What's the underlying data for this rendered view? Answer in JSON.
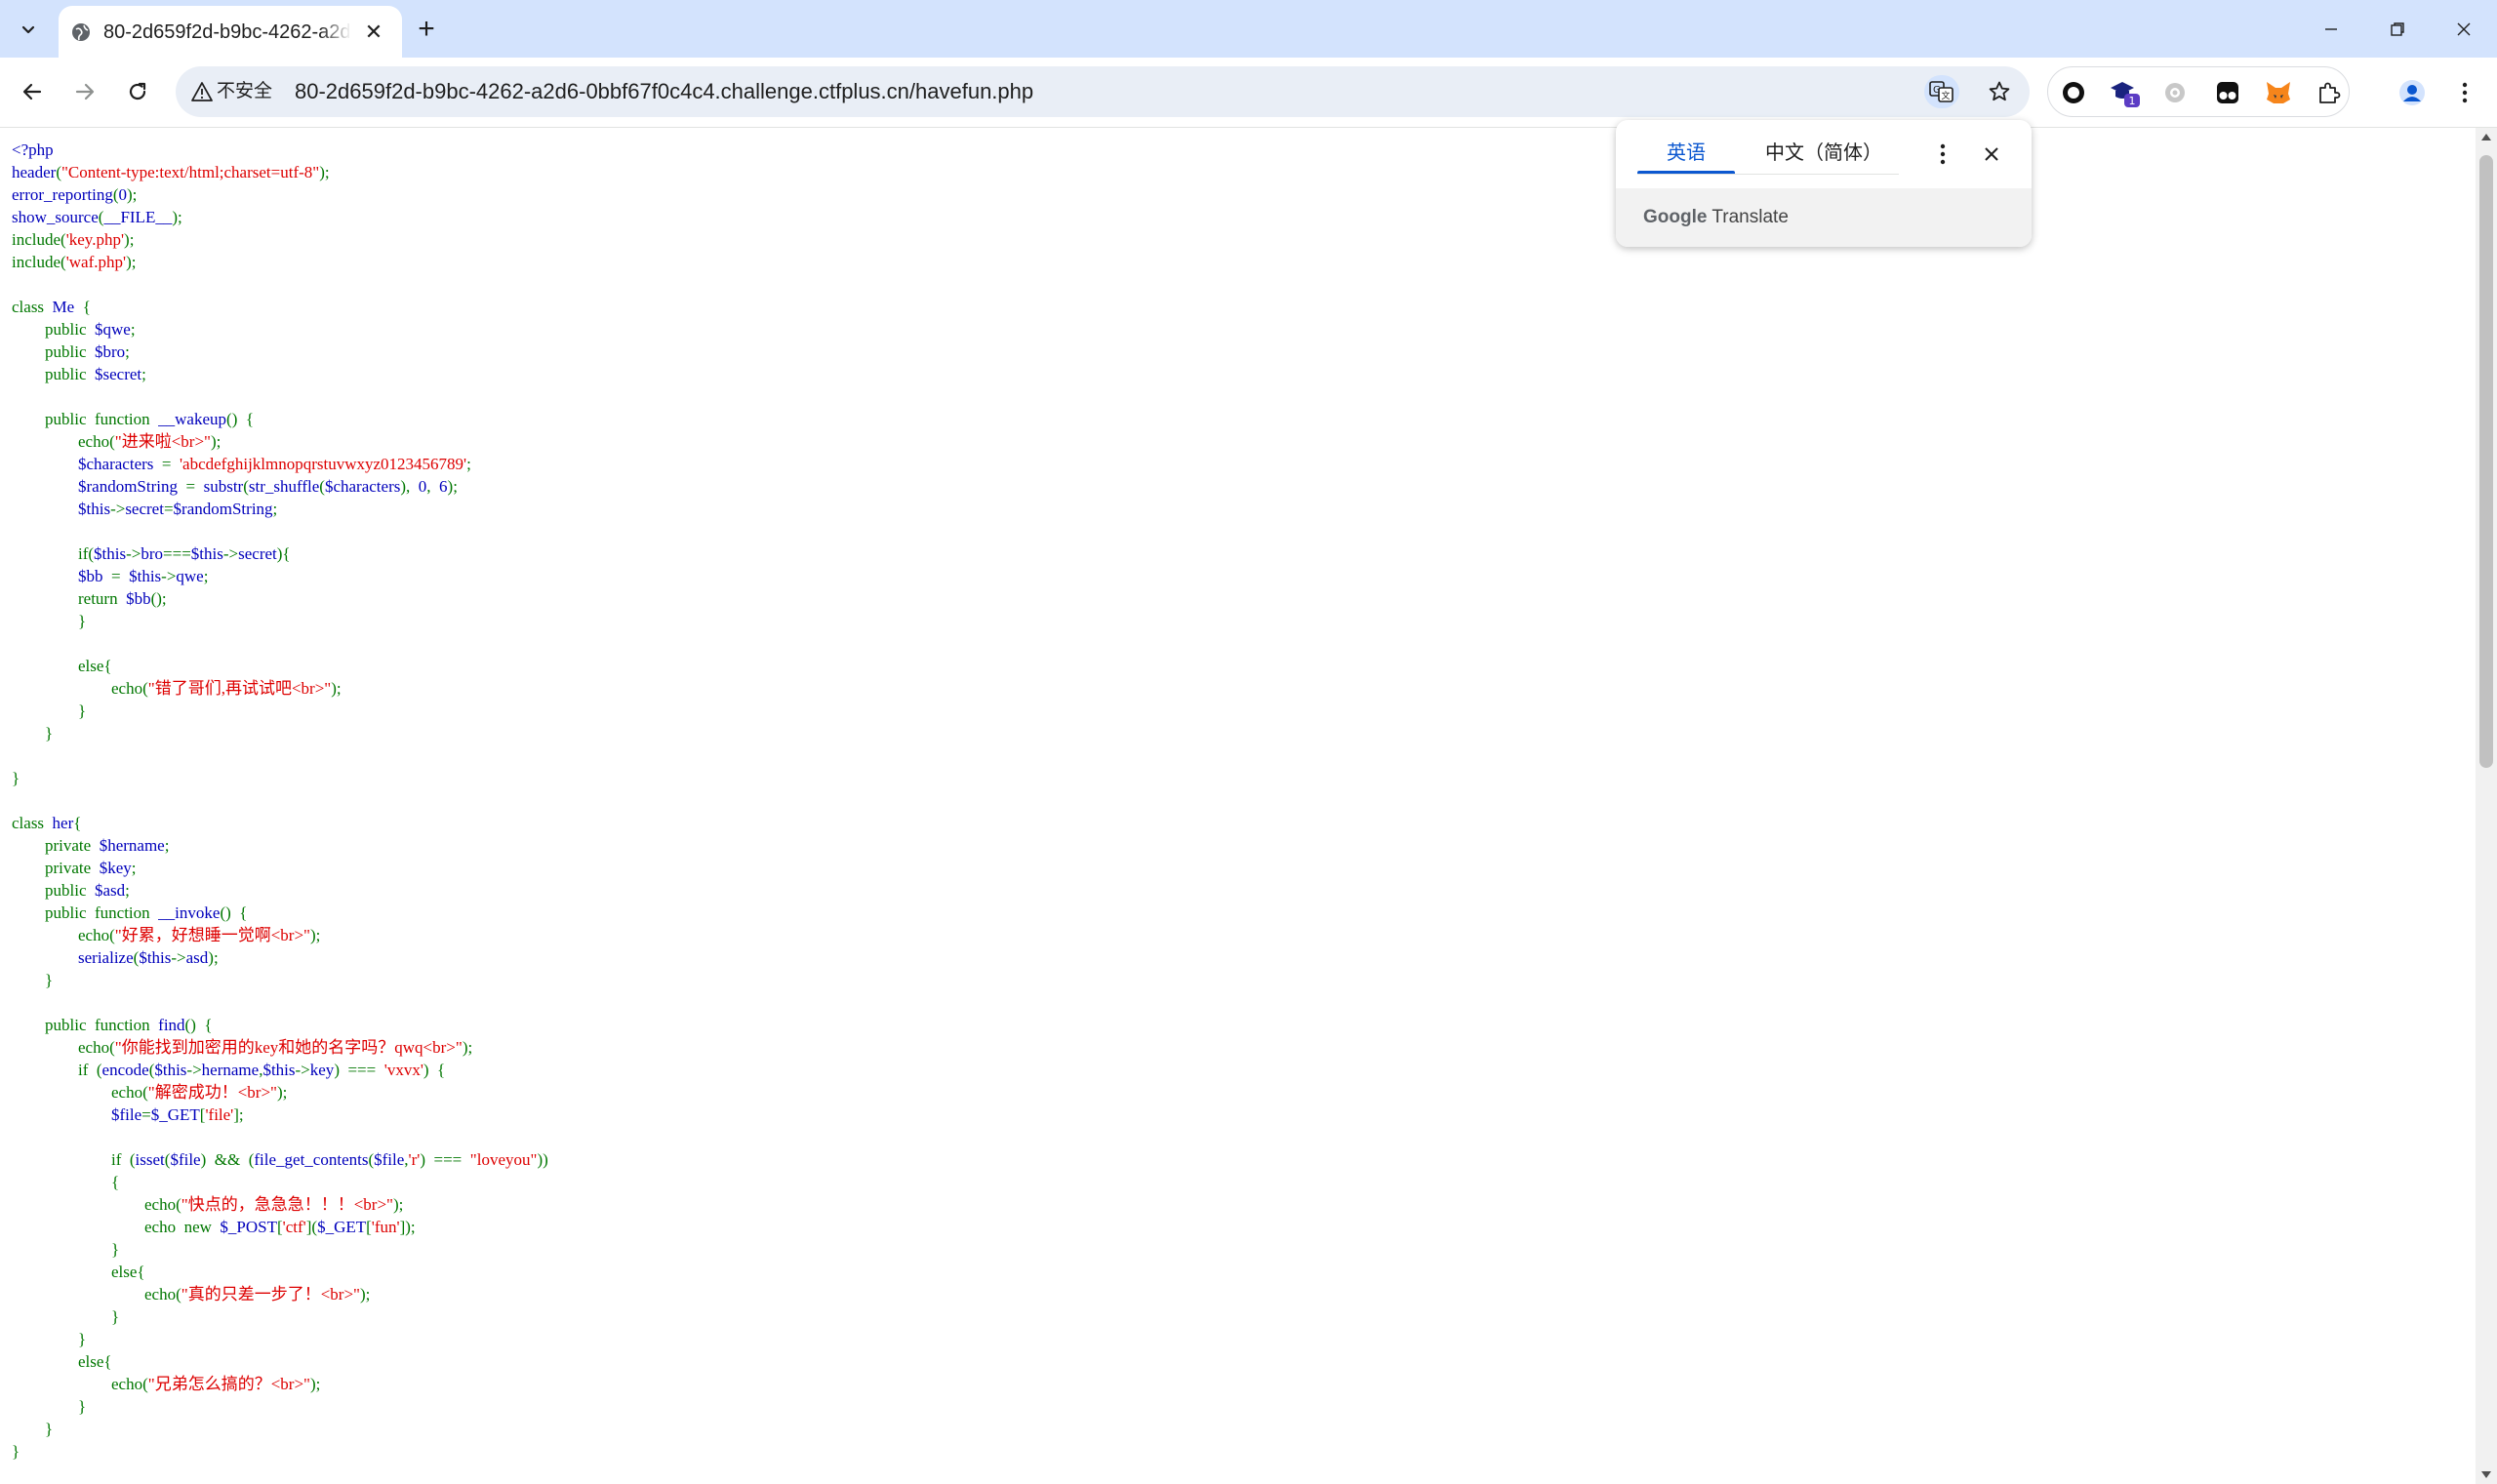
{
  "tab": {
    "title": "80-2d659f2d-b9bc-4262-a2d6-0bbf67f0c4c4.challenge.ctfplus.cn/havefun.php",
    "close_glyph": "✕",
    "new_tab_glyph": "+",
    "search_glyph": "⌄"
  },
  "address_bar": {
    "security_label": "不安全",
    "url": "80-2d659f2d-b9bc-4262-a2d6-0bbf67f0c4c4.challenge.ctfplus.cn/havefun.php"
  },
  "translate_popup": {
    "tab_source": "英语",
    "tab_target": "中文（简体）",
    "brand_google": "Google",
    "brand_translate": "Translate"
  },
  "icons": {
    "back": "back-arrow-icon",
    "forward": "forward-arrow-icon",
    "reload": "reload-icon",
    "warning": "warning-icon",
    "translate": "translate-icon",
    "bookmark": "star-icon",
    "profile": "profile-icon",
    "menu": "kebab-menu-icon"
  },
  "extensions": [
    {
      "name": "record-extension-icon"
    },
    {
      "name": "graduation-cap-extension-icon",
      "badge": "1"
    },
    {
      "name": "gear-extension-icon"
    },
    {
      "name": "tampermonkey-extension-icon"
    },
    {
      "name": "metamask-fox-extension-icon"
    },
    {
      "name": "puzzle-piece-extension-icon"
    }
  ],
  "code_lines": [
    [
      [
        "d",
        "<?php"
      ]
    ],
    [
      [
        "d",
        "header"
      ],
      [
        "k",
        "("
      ],
      [
        "s",
        "\"Content-type:text/html;charset=utf-8\""
      ],
      [
        "k",
        ");"
      ]
    ],
    [
      [
        "d",
        "error_reporting"
      ],
      [
        "k",
        "("
      ],
      [
        "d",
        "0"
      ],
      [
        "k",
        ");"
      ]
    ],
    [
      [
        "d",
        "show_source"
      ],
      [
        "k",
        "("
      ],
      [
        "d",
        "__FILE__"
      ],
      [
        "k",
        ");"
      ]
    ],
    [
      [
        "k",
        "include("
      ],
      [
        "s",
        "'key.php'"
      ],
      [
        "k",
        ");"
      ]
    ],
    [
      [
        "k",
        "include("
      ],
      [
        "s",
        "'waf.php'"
      ],
      [
        "k",
        ");"
      ]
    ],
    [],
    [
      [
        "k",
        "class  "
      ],
      [
        "d",
        "Me  "
      ],
      [
        "k",
        "{"
      ]
    ],
    [
      [
        "d",
        "\t"
      ],
      [
        "k",
        "public  "
      ],
      [
        "d",
        "$qwe"
      ],
      [
        "k",
        ";"
      ]
    ],
    [
      [
        "d",
        "\t"
      ],
      [
        "k",
        "public  "
      ],
      [
        "d",
        "$bro"
      ],
      [
        "k",
        ";"
      ]
    ],
    [
      [
        "d",
        "\t"
      ],
      [
        "k",
        "public  "
      ],
      [
        "d",
        "$secret"
      ],
      [
        "k",
        ";"
      ]
    ],
    [],
    [
      [
        "d",
        "\t"
      ],
      [
        "k",
        "public  function  "
      ],
      [
        "d",
        "__wakeup"
      ],
      [
        "k",
        "()  {"
      ]
    ],
    [
      [
        "d",
        "\t\t"
      ],
      [
        "k",
        "echo("
      ],
      [
        "s",
        "\"进来啦<br>\""
      ],
      [
        "k",
        ");"
      ]
    ],
    [
      [
        "d",
        "\t\t$characters  "
      ],
      [
        "k",
        "=  "
      ],
      [
        "s",
        "'abcdefghijklmnopqrstuvwxyz0123456789'"
      ],
      [
        "k",
        ";"
      ]
    ],
    [
      [
        "d",
        "\t\t$randomString  "
      ],
      [
        "k",
        "=  "
      ],
      [
        "d",
        "substr"
      ],
      [
        "k",
        "("
      ],
      [
        "d",
        "str_shuffle"
      ],
      [
        "k",
        "("
      ],
      [
        "d",
        "$characters"
      ],
      [
        "k",
        "),  "
      ],
      [
        "d",
        "0"
      ],
      [
        "k",
        ",  "
      ],
      [
        "d",
        "6"
      ],
      [
        "k",
        ");"
      ]
    ],
    [
      [
        "d",
        "\t\t$this"
      ],
      [
        "k",
        "->"
      ],
      [
        "d",
        "secret"
      ],
      [
        "k",
        "="
      ],
      [
        "d",
        "$randomString"
      ],
      [
        "k",
        ";"
      ]
    ],
    [],
    [
      [
        "d",
        "\t\t"
      ],
      [
        "k",
        "if("
      ],
      [
        "d",
        "$this"
      ],
      [
        "k",
        "->"
      ],
      [
        "d",
        "bro"
      ],
      [
        "k",
        "==="
      ],
      [
        "d",
        "$this"
      ],
      [
        "k",
        "->"
      ],
      [
        "d",
        "secret"
      ],
      [
        "k",
        "){"
      ]
    ],
    [
      [
        "d",
        "\t\t$bb  "
      ],
      [
        "k",
        "=  "
      ],
      [
        "d",
        "$this"
      ],
      [
        "k",
        "->"
      ],
      [
        "d",
        "qwe"
      ],
      [
        "k",
        ";"
      ]
    ],
    [
      [
        "d",
        "\t\t"
      ],
      [
        "k",
        "return  "
      ],
      [
        "d",
        "$bb"
      ],
      [
        "k",
        "();"
      ]
    ],
    [
      [
        "d",
        "\t\t"
      ],
      [
        "k",
        "}"
      ]
    ],
    [],
    [
      [
        "d",
        "\t\t"
      ],
      [
        "k",
        "else{"
      ]
    ],
    [
      [
        "d",
        "\t\t\t"
      ],
      [
        "k",
        "echo("
      ],
      [
        "s",
        "\"错了哥们,再试试吧<br>\""
      ],
      [
        "k",
        ");"
      ]
    ],
    [
      [
        "d",
        "\t\t"
      ],
      [
        "k",
        "}"
      ]
    ],
    [
      [
        "d",
        "\t"
      ],
      [
        "k",
        "}"
      ]
    ],
    [],
    [
      [
        "k",
        "}"
      ]
    ],
    [],
    [
      [
        "k",
        "class  "
      ],
      [
        "d",
        "her"
      ],
      [
        "k",
        "{"
      ]
    ],
    [
      [
        "d",
        "\t"
      ],
      [
        "k",
        "private  "
      ],
      [
        "d",
        "$hername"
      ],
      [
        "k",
        ";"
      ]
    ],
    [
      [
        "d",
        "\t"
      ],
      [
        "k",
        "private  "
      ],
      [
        "d",
        "$key"
      ],
      [
        "k",
        ";"
      ]
    ],
    [
      [
        "d",
        "\t"
      ],
      [
        "k",
        "public  "
      ],
      [
        "d",
        "$asd"
      ],
      [
        "k",
        ";"
      ]
    ],
    [
      [
        "d",
        "\t"
      ],
      [
        "k",
        "public  function  "
      ],
      [
        "d",
        "__invoke"
      ],
      [
        "k",
        "()  {"
      ]
    ],
    [
      [
        "d",
        "\t\t"
      ],
      [
        "k",
        "echo("
      ],
      [
        "s",
        "\"好累，好想睡一觉啊<br>\""
      ],
      [
        "k",
        ");"
      ]
    ],
    [
      [
        "d",
        "\t\t"
      ],
      [
        "d",
        "serialize"
      ],
      [
        "k",
        "("
      ],
      [
        "d",
        "$this"
      ],
      [
        "k",
        "->"
      ],
      [
        "d",
        "asd"
      ],
      [
        "k",
        ");"
      ]
    ],
    [
      [
        "d",
        "\t"
      ],
      [
        "k",
        "}"
      ]
    ],
    [],
    [
      [
        "d",
        "\t"
      ],
      [
        "k",
        "public  function  "
      ],
      [
        "d",
        "find"
      ],
      [
        "k",
        "()  {"
      ]
    ],
    [
      [
        "d",
        "\t\t"
      ],
      [
        "k",
        "echo("
      ],
      [
        "s",
        "\"你能找到加密用的key和她的名字吗？qwq<br>\""
      ],
      [
        "k",
        ");"
      ]
    ],
    [
      [
        "d",
        "\t\t"
      ],
      [
        "k",
        "if  ("
      ],
      [
        "d",
        "encode"
      ],
      [
        "k",
        "("
      ],
      [
        "d",
        "$this"
      ],
      [
        "k",
        "->"
      ],
      [
        "d",
        "hername"
      ],
      [
        "k",
        ","
      ],
      [
        "d",
        "$this"
      ],
      [
        "k",
        "->"
      ],
      [
        "d",
        "key"
      ],
      [
        "k",
        ")  ===  "
      ],
      [
        "s",
        "'vxvx'"
      ],
      [
        "k",
        ")  {"
      ]
    ],
    [
      [
        "d",
        "\t\t\t"
      ],
      [
        "k",
        "echo("
      ],
      [
        "s",
        "\"解密成功！<br>\""
      ],
      [
        "k",
        ");"
      ]
    ],
    [
      [
        "d",
        "\t\t\t$file"
      ],
      [
        "k",
        "="
      ],
      [
        "d",
        "$_GET"
      ],
      [
        "k",
        "["
      ],
      [
        "s",
        "'file'"
      ],
      [
        "k",
        "];"
      ]
    ],
    [],
    [
      [
        "d",
        "\t\t\t"
      ],
      [
        "k",
        "if  ("
      ],
      [
        "d",
        "isset"
      ],
      [
        "k",
        "("
      ],
      [
        "d",
        "$file"
      ],
      [
        "k",
        ")  &&  ("
      ],
      [
        "d",
        "file_get_contents"
      ],
      [
        "k",
        "("
      ],
      [
        "d",
        "$file"
      ],
      [
        "k",
        ","
      ],
      [
        "s",
        "'r'"
      ],
      [
        "k",
        ")  ===  "
      ],
      [
        "s",
        "\"loveyou\""
      ],
      [
        "k",
        "))"
      ]
    ],
    [
      [
        "d",
        "\t\t\t"
      ],
      [
        "k",
        "{"
      ]
    ],
    [
      [
        "d",
        "\t\t\t\t"
      ],
      [
        "k",
        "echo("
      ],
      [
        "s",
        "\"快点的，急急急！！！<br>\""
      ],
      [
        "k",
        ");"
      ]
    ],
    [
      [
        "d",
        "\t\t\t\t"
      ],
      [
        "k",
        "echo  new  "
      ],
      [
        "d",
        "$_POST"
      ],
      [
        "k",
        "["
      ],
      [
        "s",
        "'ctf'"
      ],
      [
        "k",
        "]("
      ],
      [
        "d",
        "$_GET"
      ],
      [
        "k",
        "["
      ],
      [
        "s",
        "'fun'"
      ],
      [
        "k",
        "]);"
      ]
    ],
    [
      [
        "d",
        "\t\t\t"
      ],
      [
        "k",
        "}"
      ]
    ],
    [
      [
        "d",
        "\t\t\t"
      ],
      [
        "k",
        "else{"
      ]
    ],
    [
      [
        "d",
        "\t\t\t\t"
      ],
      [
        "k",
        "echo("
      ],
      [
        "s",
        "\"真的只差一步了！<br>\""
      ],
      [
        "k",
        ");"
      ]
    ],
    [
      [
        "d",
        "\t\t\t"
      ],
      [
        "k",
        "}"
      ]
    ],
    [
      [
        "d",
        "\t\t"
      ],
      [
        "k",
        "}"
      ]
    ],
    [
      [
        "d",
        "\t\t"
      ],
      [
        "k",
        "else{"
      ]
    ],
    [
      [
        "d",
        "\t\t\t"
      ],
      [
        "k",
        "echo("
      ],
      [
        "s",
        "\"兄弟怎么搞的？<br>\""
      ],
      [
        "k",
        ");"
      ]
    ],
    [
      [
        "d",
        "\t\t"
      ],
      [
        "k",
        "}"
      ]
    ],
    [
      [
        "d",
        "\t"
      ],
      [
        "k",
        "}"
      ]
    ],
    [
      [
        "k",
        "}"
      ]
    ]
  ]
}
